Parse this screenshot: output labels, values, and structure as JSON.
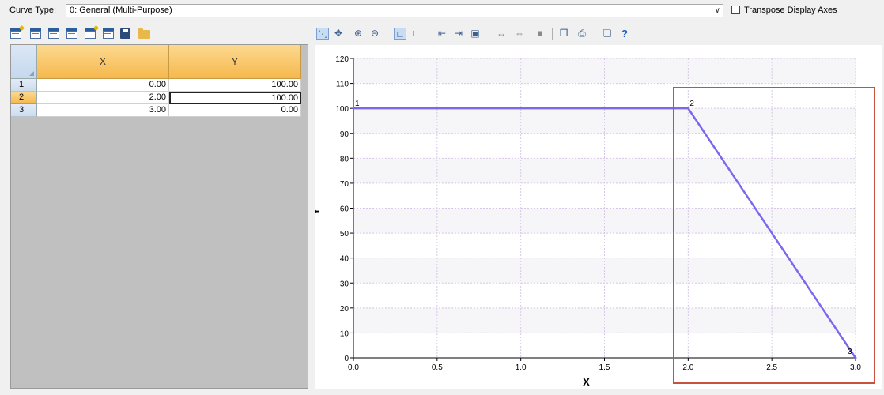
{
  "curve_type": {
    "label": "Curve Type:",
    "value": "0: General (Multi-Purpose)"
  },
  "transpose": {
    "label": "Transpose Display Axes",
    "checked": false
  },
  "left_toolbar": {
    "icons": [
      "add-row-icon",
      "insert-row-icon",
      "delete-row-icon",
      "table-columns-icon",
      "table-edit-icon",
      "table-import-icon",
      "save-icon",
      "open-folder-icon"
    ]
  },
  "grid": {
    "columns": [
      "X",
      "Y"
    ],
    "rows": [
      {
        "index": "1",
        "x": "0.00",
        "y": "100.00"
      },
      {
        "index": "2",
        "x": "2.00",
        "y": "100.00"
      },
      {
        "index": "3",
        "x": "3.00",
        "y": "0.00"
      }
    ],
    "selected_row": 1
  },
  "chart_toolbar": {
    "icons": [
      "line-chart-icon",
      "pan-icon",
      "zoom-in-icon",
      "zoom-out-icon",
      "axis-label-icon",
      "axis-label-alt-icon",
      "align-left-icon",
      "align-right-icon",
      "fit-view-icon",
      "expand-horizontal-icon",
      "shrink-horizontal-icon",
      "stop-icon",
      "copy-icon",
      "print-icon",
      "window-icon",
      "help-icon"
    ]
  },
  "highlight_color": "#c8513b",
  "line_color": "#7b68ee",
  "chart_data": {
    "type": "line",
    "xlabel": "X",
    "ylabel": "Y",
    "xlim": [
      0,
      3
    ],
    "ylim": [
      0,
      120
    ],
    "xticks": [
      "0.0",
      "0.5",
      "1.0",
      "1.5",
      "2.0",
      "2.5",
      "3.0"
    ],
    "yticks": [
      "0",
      "10",
      "20",
      "30",
      "40",
      "50",
      "60",
      "70",
      "80",
      "90",
      "100",
      "110",
      "120"
    ],
    "grid": true,
    "series": [
      {
        "x": [
          0,
          2,
          3
        ],
        "y": [
          100,
          100,
          0
        ],
        "point_labels": [
          "1",
          "2",
          "3"
        ]
      }
    ]
  }
}
